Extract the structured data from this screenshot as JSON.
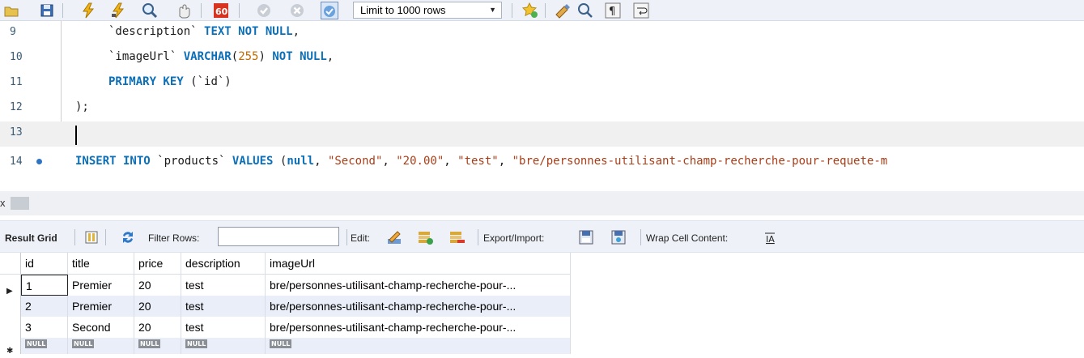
{
  "toolbar": {
    "limit_label": "Limit to 1000 rows",
    "icons": [
      "open-folder-icon",
      "save-icon",
      "execute-icon",
      "execute-current-icon",
      "explain-icon",
      "stop-icon",
      "toggle-continue-icon",
      "commit-icon",
      "rollback-icon",
      "autocommit-icon",
      "add-snippet-icon",
      "beautify-icon",
      "find-icon",
      "invisible-chars-icon",
      "wrap-icon"
    ]
  },
  "editor": {
    "lines": [
      {
        "num": "9"
      },
      {
        "num": "10"
      },
      {
        "num": "11"
      },
      {
        "num": "12"
      },
      {
        "num": "13"
      },
      {
        "num": "14"
      }
    ],
    "tokens": {
      "l9_col": "`description`",
      "l9_kw": "TEXT NOT NULL",
      "l9_end": ",",
      "l10_col": "`imageUrl`",
      "l10_kw1": "VARCHAR",
      "l10_p1": "(",
      "l10_num": "255",
      "l10_p2": ")",
      "l10_kw2": "NOT NULL",
      "l10_end": ",",
      "l11_kw": "PRIMARY KEY",
      "l11_rest": "(`id`)",
      "l12": ");",
      "l14_kw1": "INSERT INTO",
      "l14_tbl": "`products`",
      "l14_kw2": "VALUES",
      "l14_p": "(",
      "l14_null": "null",
      "l14_c1": ",",
      "l14_s1": "\"Second\"",
      "l14_c2": ",",
      "l14_s2": "\"20.00\"",
      "l14_c3": ",",
      "l14_s3": "\"test\"",
      "l14_c4": ",",
      "l14_s4": "\"bre/personnes-utilisant-champ-recherche-pour-requete-m"
    }
  },
  "splitter": {
    "close_label": "x"
  },
  "result_toolbar": {
    "result_grid": "Result Grid",
    "filter_rows": "Filter Rows:",
    "edit": "Edit:",
    "export_import": "Export/Import:",
    "wrap_cell": "Wrap Cell Content:"
  },
  "grid": {
    "columns": [
      "id",
      "title",
      "price",
      "description",
      "imageUrl"
    ],
    "rows": [
      [
        "1",
        "Premier",
        "20",
        "test",
        "bre/personnes-utilisant-champ-recherche-pour-..."
      ],
      [
        "2",
        "Premier",
        "20",
        "test",
        "bre/personnes-utilisant-champ-recherche-pour-..."
      ],
      [
        "3",
        "Second",
        "20",
        "test",
        "bre/personnes-utilisant-champ-recherche-pour-..."
      ]
    ],
    "null_label": "NULL",
    "current_marker": "▶",
    "new_row_marker": "✱"
  }
}
